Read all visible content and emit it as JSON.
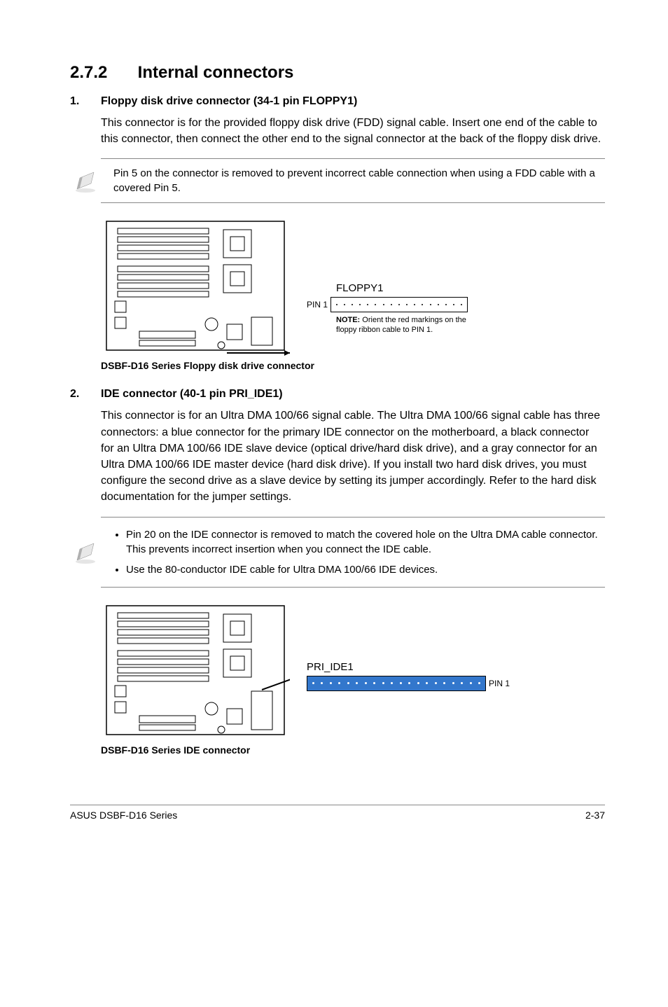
{
  "section": {
    "num": "2.7.2",
    "title": "Internal connectors"
  },
  "item1": {
    "idx": "1.",
    "title": "Floppy disk drive connector (34-1 pin FLOPPY1)",
    "para": "This connector is for the provided floppy disk drive (FDD) signal cable. Insert one end of the cable to this connector, then connect the other end to the signal connector at the back of the floppy disk drive.",
    "note": "Pin 5 on the connector is removed to prevent incorrect cable connection when using a FDD cable with a covered Pin 5.",
    "conn_label": "FLOPPY1",
    "pin_label": "PIN 1",
    "note_small_bold": "NOTE:",
    "note_small": " Orient the red markings on the floppy ribbon cable to PIN 1.",
    "caption": "DSBF-D16 Series Floppy disk drive connector"
  },
  "item2": {
    "idx": "2.",
    "title": "IDE connector (40-1 pin PRI_IDE1)",
    "para": "This connector is for an Ultra DMA 100/66 signal cable. The Ultra DMA 100/66 signal cable has three connectors: a blue connector for the primary IDE connector on the motherboard, a black connector for an Ultra DMA 100/66 IDE slave device (optical drive/hard disk drive), and a gray connector for an Ultra DMA 100/66 IDE master device (hard disk drive). If you install two hard disk drives, you must configure the second drive as a slave device by setting its jumper accordingly. Refer to the hard disk documentation for the jumper settings.",
    "bullet1": "Pin 20 on the IDE connector is removed to match the covered hole on the Ultra DMA cable connector. This prevents incorrect insertion when you connect the IDE cable.",
    "bullet2": "Use the 80-conductor IDE cable for Ultra DMA 100/66 IDE devices.",
    "conn_label": "PRI_IDE1",
    "pin_label": "PIN 1",
    "caption": "DSBF-D16 Series IDE connector"
  },
  "footer": {
    "left": "ASUS DSBF-D16 Series",
    "right": "2-37"
  }
}
